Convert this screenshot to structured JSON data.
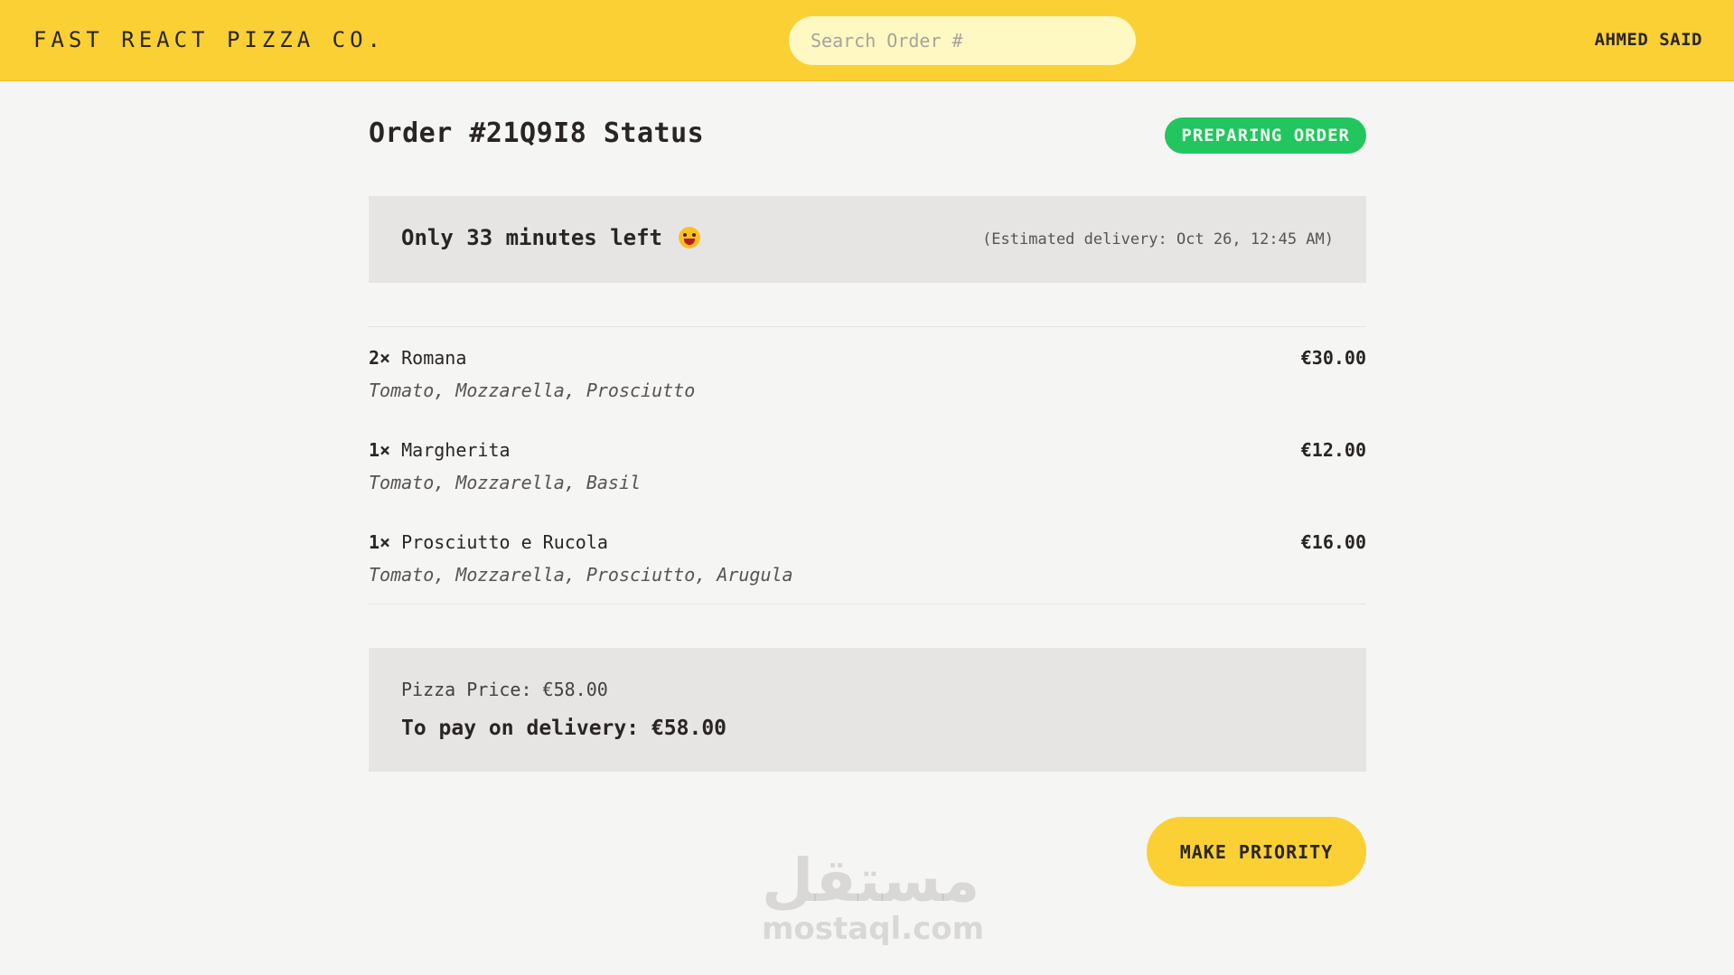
{
  "header": {
    "logo": "FAST REACT PIZZA CO.",
    "search_placeholder": "Search Order #",
    "username": "AHMED SAID",
    "accent_color": "#fad034"
  },
  "order": {
    "title": "Order #21Q9I8 Status",
    "status": "PREPARING ORDER",
    "status_color": "#22c55e",
    "eta_text": "Only 33 minutes left",
    "eta_emoji": "smiling-face-with-tongue-icon",
    "estimated_delivery": "(Estimated delivery: Oct 26, 12:45 AM)"
  },
  "items": [
    {
      "qty": "2×",
      "name": "Romana",
      "price": "€30.00",
      "ingredients": "Tomato, Mozzarella, Prosciutto"
    },
    {
      "qty": "1×",
      "name": "Margherita",
      "price": "€12.00",
      "ingredients": "Tomato, Mozzarella, Basil"
    },
    {
      "qty": "1×",
      "name": "Prosciutto e Rucola",
      "price": "€16.00",
      "ingredients": "Tomato, Mozzarella, Prosciutto, Arugula"
    }
  ],
  "summary": {
    "pizza_price": "Pizza Price: €58.00",
    "to_pay": "To pay on delivery: €58.00"
  },
  "actions": {
    "priority_label": "MAKE PRIORITY"
  },
  "watermark": {
    "arabic": "مستقل",
    "latin": "mostaql.com"
  }
}
